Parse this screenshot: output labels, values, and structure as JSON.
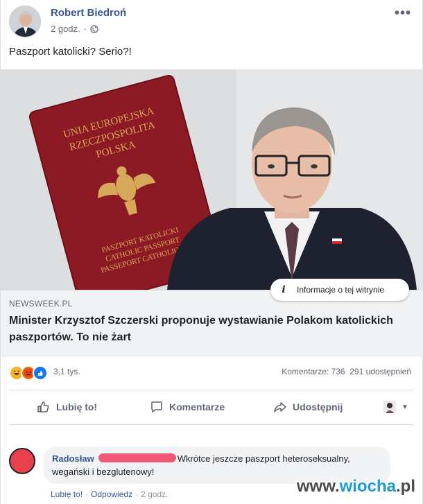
{
  "post": {
    "author": "Robert Biedroń",
    "time": "2 godz.",
    "text": "Paszport katolicki? Serio?!",
    "more_icon": "ellipsis-icon"
  },
  "photo": {
    "passport_lines": [
      "UNIA EUROPEJSKA",
      "RZECZPOSPOLITA",
      "POLSKA"
    ],
    "passport_bottom_lines": [
      "PASZPORT KATOLICKI",
      "CATHOLIC PASSPORT",
      "PASSEPORT CATHOLIQUE"
    ]
  },
  "info_pill": "Informacje o tej witrynie",
  "link": {
    "domain": "NEWSWEEK.PL",
    "headline": "Minister Krzysztof Szczerski proponuje wystawianie Polakom katolickich paszportów. To nie żart"
  },
  "stats": {
    "reaction_count": "3,1 tys.",
    "comments": "Komentarze: 736",
    "shares": "291 udostępnień"
  },
  "actions": {
    "like": "Lubię to!",
    "comment": "Komentarze",
    "share": "Udostępnij"
  },
  "comment": {
    "name": "Radosław",
    "text": "Wkrótce jeszcze paszport heteroseksualny, wegański i bezglutenowy!",
    "like": "Lubię to!",
    "reply": "Odpowiedz",
    "time": "2 godz."
  },
  "watermark": {
    "pre": "www.",
    "mid": "wiocha",
    "post": ".pl"
  },
  "colors": {
    "link_blue": "#385898",
    "passport_red": "#8b1a24",
    "like_blue": "#1877f2"
  }
}
